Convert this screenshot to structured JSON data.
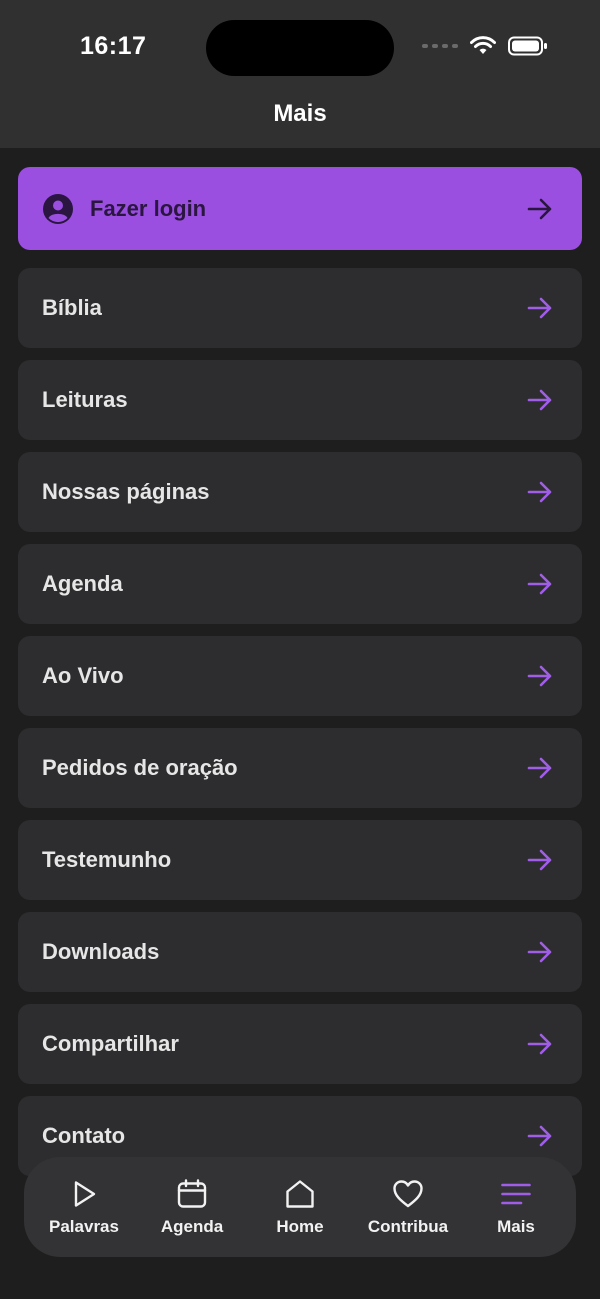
{
  "status": {
    "time": "16:17"
  },
  "header": {
    "title": "Mais"
  },
  "login": {
    "label": "Fazer login"
  },
  "menu": {
    "items": [
      {
        "id": "biblia",
        "label": "Bíblia"
      },
      {
        "id": "leituras",
        "label": "Leituras"
      },
      {
        "id": "nossas-paginas",
        "label": "Nossas páginas"
      },
      {
        "id": "agenda",
        "label": "Agenda"
      },
      {
        "id": "ao-vivo",
        "label": "Ao Vivo"
      },
      {
        "id": "pedidos-de-oracao",
        "label": "Pedidos de oração"
      },
      {
        "id": "testemunho",
        "label": "Testemunho"
      },
      {
        "id": "downloads",
        "label": "Downloads"
      },
      {
        "id": "compartilhar",
        "label": "Compartilhar"
      },
      {
        "id": "contato",
        "label": "Contato"
      }
    ]
  },
  "tabs": [
    {
      "id": "palavras",
      "label": "Palavras",
      "icon": "play-icon"
    },
    {
      "id": "agenda",
      "label": "Agenda",
      "icon": "calendar-icon"
    },
    {
      "id": "home",
      "label": "Home",
      "icon": "home-icon"
    },
    {
      "id": "contribua",
      "label": "Contribua",
      "icon": "heart-icon"
    },
    {
      "id": "mais",
      "label": "Mais",
      "icon": "menu-icon",
      "active": true
    }
  ],
  "colors": {
    "accent": "#9a4fe0",
    "arrow": "#a05ee8",
    "background": "#1e1e1e",
    "card": "#2d2d2f",
    "header": "#303030"
  }
}
